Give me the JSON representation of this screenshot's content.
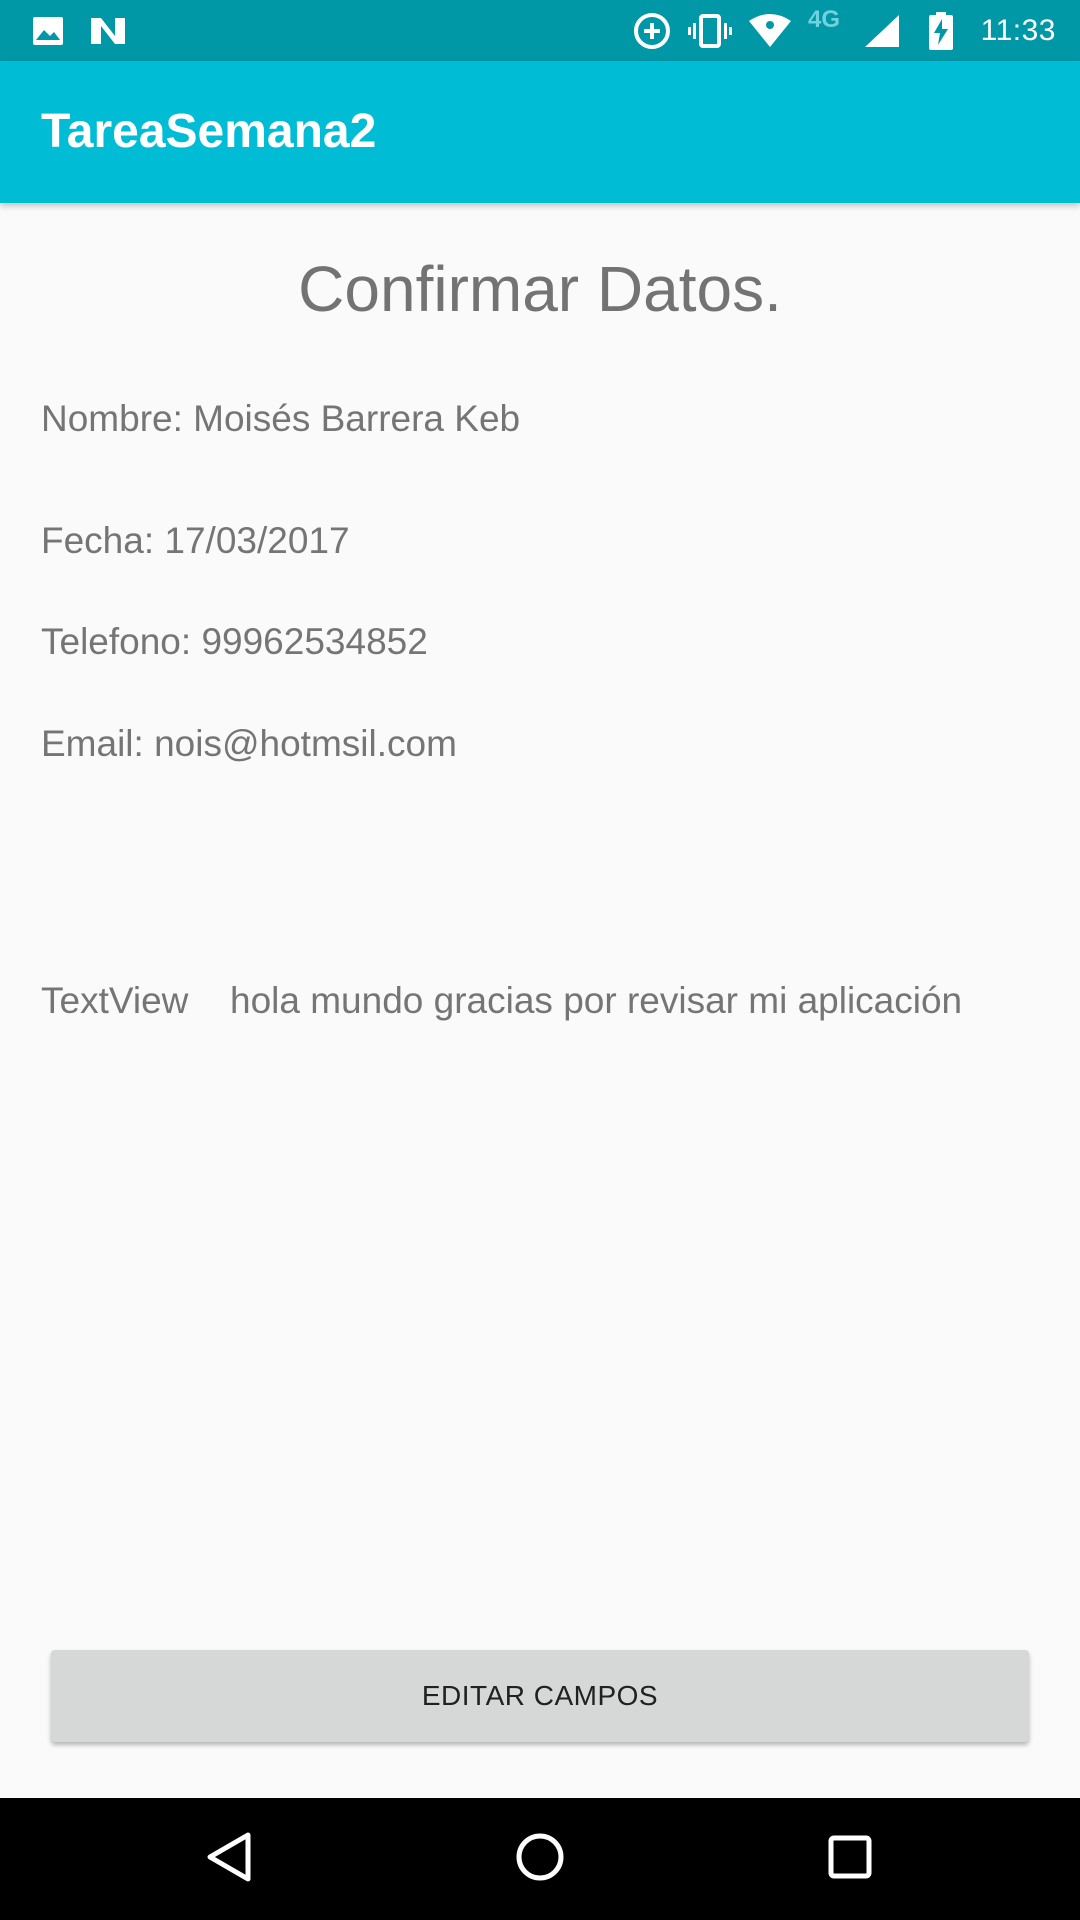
{
  "status_bar": {
    "time": "11:33",
    "network": "4G",
    "icons": [
      "image-notification-icon",
      "n-notification-icon",
      "data-saver-icon",
      "vibrate-icon",
      "wifi-icon",
      "signal-icon",
      "battery-charging-icon"
    ]
  },
  "app_bar": {
    "title": "TareaSemana2",
    "color": "#00BCD4",
    "status_color": "#0097A7"
  },
  "content": {
    "heading": "Confirmar Datos.",
    "name": "Nombre: Moisés Barrera Keb",
    "date": "Fecha: 17/03/2017",
    "phone": "Telefono: 99962534852",
    "email": "Email: nois@hotmsil.com",
    "textview_label": "TextView",
    "message": "hola mundo gracias por revisar mi aplicación"
  },
  "actions": {
    "edit_label": "EDITAR CAMPOS"
  },
  "nav_bar": {
    "icons": [
      "back-icon",
      "home-icon",
      "recents-icon"
    ]
  }
}
